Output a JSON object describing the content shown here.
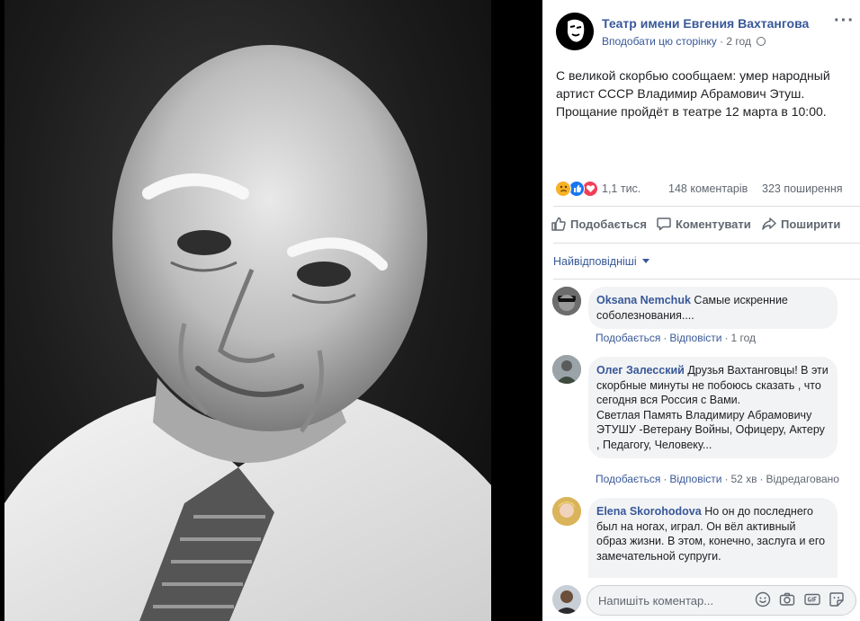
{
  "post": {
    "page_name": "Театр имени Евгения Вахтангова",
    "follow_label": "Вподобати цю сторінку",
    "separator": "·",
    "time": "2 год",
    "more": "···",
    "text": "С великой скорбью сообщаем: умер народный артист СССР Владимир Абрамович Этуш. Прощание пройдёт в театре 12 марта в 10:00."
  },
  "stats": {
    "reactions": "1,1 тис.",
    "comments": "148 коментарів",
    "shares": "323 поширення",
    "reaction_icons": [
      "sad-reaction-icon",
      "like-reaction-icon",
      "love-reaction-icon"
    ]
  },
  "actions": {
    "like": "Подобається",
    "comment": "Коментувати",
    "share": "Поширити"
  },
  "comments_sort": "Найвідповідніші",
  "comments": [
    {
      "author": "Oksana Nemchuk",
      "text": "Самые искренние соболезнования....",
      "like": "Подобається",
      "reply": "Відповісти",
      "time": "1 год",
      "edited": ""
    },
    {
      "author": "Олег Залесский",
      "text": "Друзья Вахтанговцы! В эти скорбные минуты не побоюсь сказать , что сегодня вся Россия с Вами.\nСветлая Память Владимиру Абрамовичу ЭТУШУ -Ветерану Войны, Офицеру, Актеру , Педагогу, Человеку...",
      "like": "Подобається",
      "reply": "Відповісти",
      "time": "52 хв",
      "edited": "Відредаговано"
    },
    {
      "author": "Elena Skorohodova",
      "text": "Но он до последнего был на ногах, играл. Он вёл активный образ жизни. В этом, конечно, заслуга и его замечательной супруги.",
      "like": "",
      "reply": "",
      "time": "",
      "edited": ""
    }
  ],
  "composer": {
    "placeholder": "Напишіть коментар..."
  },
  "colors": {
    "link": "#385898",
    "muted": "#606770",
    "bubble": "#f2f3f5",
    "like_blue": "#1877f2",
    "love_red": "#f33e58",
    "sad_yellow": "#f7b125"
  }
}
